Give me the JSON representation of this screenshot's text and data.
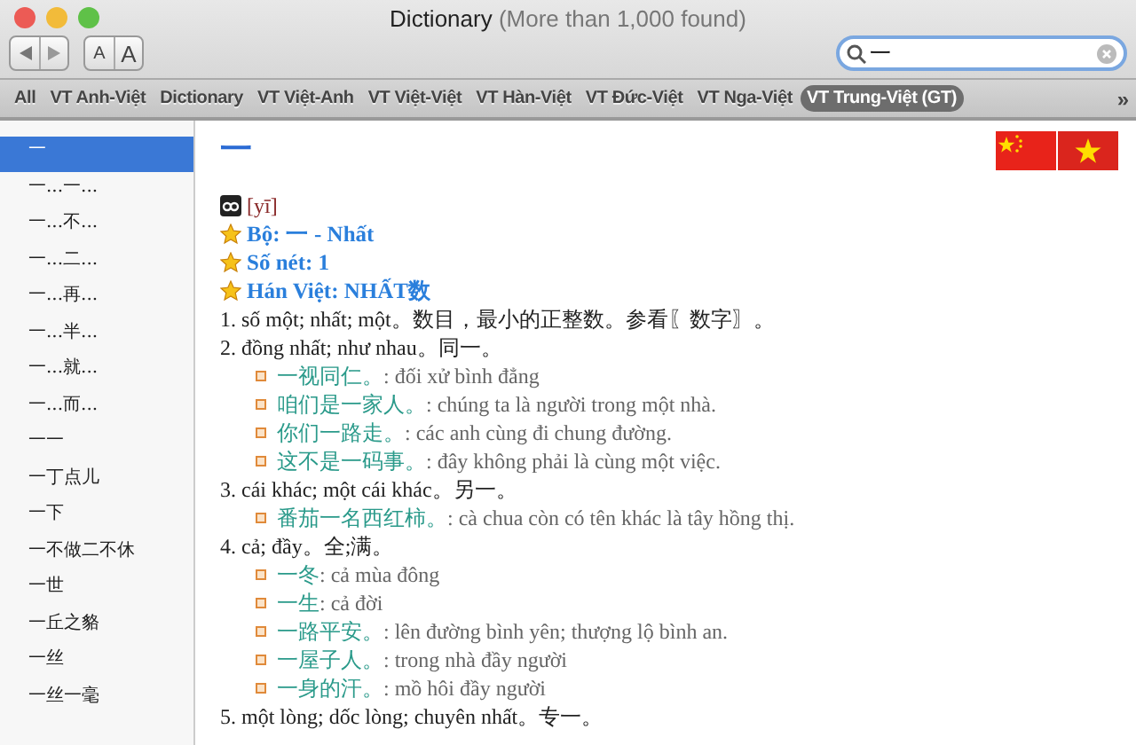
{
  "window": {
    "title": "Dictionary",
    "subtitle": "(More than 1,000 found)"
  },
  "toolbar": {
    "font_smaller": "A",
    "font_larger": "A"
  },
  "search": {
    "value": "一"
  },
  "tabs": [
    {
      "label": "All",
      "selected": false
    },
    {
      "label": "VT Anh-Việt",
      "selected": false
    },
    {
      "label": "Dictionary",
      "selected": false
    },
    {
      "label": "VT Việt-Anh",
      "selected": false
    },
    {
      "label": "VT Việt-Việt",
      "selected": false
    },
    {
      "label": "VT Hàn-Việt",
      "selected": false
    },
    {
      "label": "VT Đức-Việt",
      "selected": false
    },
    {
      "label": "VT Nga-Việt",
      "selected": false
    },
    {
      "label": "VT Trung-Việt (GT)",
      "selected": true
    }
  ],
  "overflow": "»",
  "sidebar": {
    "items": [
      {
        "label": "一",
        "selected": true
      },
      {
        "label": "一...一...",
        "selected": false
      },
      {
        "label": "一...不...",
        "selected": false
      },
      {
        "label": "一...二...",
        "selected": false
      },
      {
        "label": "一...再...",
        "selected": false
      },
      {
        "label": "一...半...",
        "selected": false
      },
      {
        "label": "一...就...",
        "selected": false
      },
      {
        "label": "一...而...",
        "selected": false
      },
      {
        "label": "一一",
        "selected": false
      },
      {
        "label": "一丁点儿",
        "selected": false
      },
      {
        "label": "一下",
        "selected": false
      },
      {
        "label": "一不做二不休",
        "selected": false
      },
      {
        "label": "一世",
        "selected": false
      },
      {
        "label": "一丘之貉",
        "selected": false
      },
      {
        "label": "一丝",
        "selected": false
      },
      {
        "label": "一丝一毫",
        "selected": false
      }
    ]
  },
  "entry": {
    "headword": "一",
    "lines": [
      {
        "kind": "pinyin",
        "text": "[yī]"
      },
      {
        "kind": "heading",
        "text": "Bộ: 一 - Nhất"
      },
      {
        "kind": "heading",
        "text": "Số nét: 1"
      },
      {
        "kind": "heading",
        "text": "Hán Việt: NHẤT数"
      },
      {
        "kind": "sense",
        "text": "1. số một; nhất; một。数目，最小的正整数。参看〖数字〗。"
      },
      {
        "kind": "sense",
        "text": "2. đồng nhất; như nhau。同一。"
      },
      {
        "kind": "example",
        "hanzi": "一视同仁。",
        "text": ": đối xử bình đẳng"
      },
      {
        "kind": "example",
        "hanzi": "咱们是一家人。",
        "text": ": chúng ta là người trong một nhà."
      },
      {
        "kind": "example",
        "hanzi": "你们一路走。",
        "text": ": các anh cùng đi chung đường."
      },
      {
        "kind": "example",
        "hanzi": "这不是一码事。",
        "text": ": đây không phải là cùng một việc."
      },
      {
        "kind": "sense",
        "text": "3. cái khác; một cái khác。另一。"
      },
      {
        "kind": "example",
        "hanzi": "番茄一名西红柿。",
        "text": ": cà chua còn có tên khác là tây hồng thị."
      },
      {
        "kind": "sense",
        "text": "4. cả; đầy。全;满。"
      },
      {
        "kind": "example",
        "hanzi": "一冬",
        "text": ": cả mùa đông"
      },
      {
        "kind": "example",
        "hanzi": "一生",
        "text": ": cả đời"
      },
      {
        "kind": "example",
        "hanzi": "一路平安。",
        "text": ": lên đường bình yên; thượng lộ bình an."
      },
      {
        "kind": "example",
        "hanzi": "一屋子人。",
        "text": ": trong nhà đầy người"
      },
      {
        "kind": "example",
        "hanzi": "一身的汗。",
        "text": ": mồ hôi đầy người"
      },
      {
        "kind": "sense",
        "text": "5. một lòng; dốc lòng; chuyên nhất。专一。"
      }
    ]
  }
}
